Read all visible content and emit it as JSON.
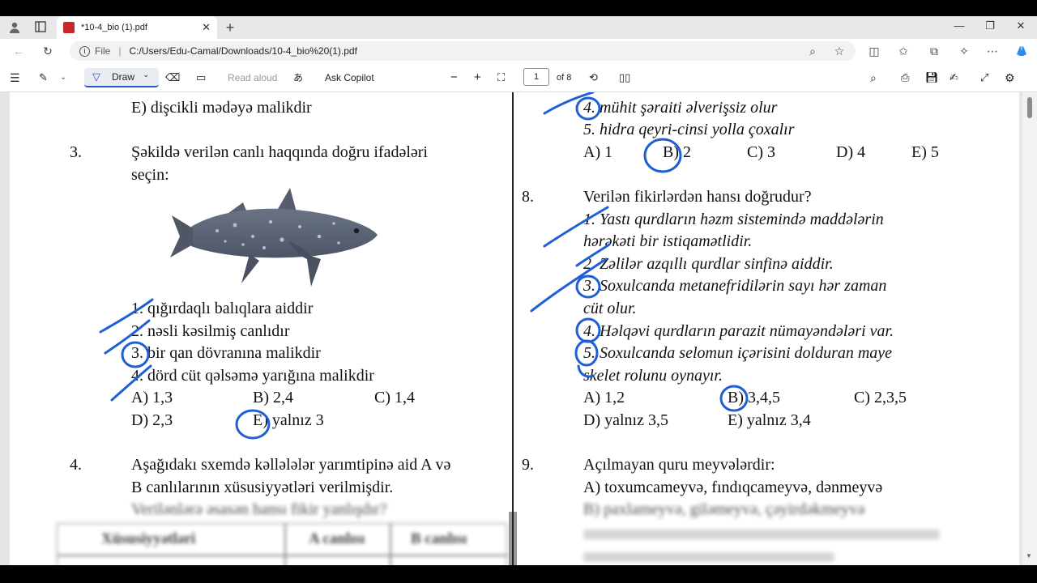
{
  "browser": {
    "tab_title": "*10-4_bio (1).pdf",
    "tab_close": "✕",
    "new_tab": "+",
    "address_prefix": "File",
    "address_url": "C:/Users/Edu-Camal/Downloads/10-4_bio%20(1).pdf"
  },
  "pdf_toolbar": {
    "draw_label": "Draw",
    "read_aloud": "Read aloud",
    "ask_copilot": "Ask Copilot",
    "page_current": "1",
    "page_total": "of 8"
  },
  "left_column": {
    "q2_option_e": "E) dişcikli mədəyə malikdir",
    "q3_number": "3.",
    "q3_text_line1": "Şəkildə verilən canlı haqqında doğru ifadələri",
    "q3_text_line2": "seçin:",
    "q3_s1": "1. qığırdaqlı balıqlara aiddir",
    "q3_s2": "2. nəsli kəsilmiş canlıdır",
    "q3_s3": "3. bir qan dövranına malikdir",
    "q3_s4": "4. dörd cüt qəlsəmə yarığına malikdir",
    "q3_a": "A) 1,3",
    "q3_b": "B) 2,4",
    "q3_c": "C) 1,4",
    "q3_d": "D) 2,3",
    "q3_e": "E) yalnız 3",
    "q4_number": "4.",
    "q4_line1": "Aşağıdakı sxemdə kəllələlər yarımtipinə aid A və",
    "q4_line2": "B canlılarının xüsusiyyətləri verilmişdir.",
    "q4_line3": "Verilənlərə əsasən hansı fikir yanlışdır?",
    "table_h1": "Xüsusiyyətləri",
    "table_h2": "A canlısı",
    "table_h3": "B canlısı"
  },
  "right_column": {
    "q7_s4": "4. mühit şəraiti əlverişsiz olur",
    "q7_s5": "5. hidra qeyri-cinsi yolla çoxalır",
    "q7_a": "A) 1",
    "q7_b": "B) 2",
    "q7_c": "C) 3",
    "q7_d": "D) 4",
    "q7_e": "E) 5",
    "q8_number": "8.",
    "q8_text": "Verilən fikirlərdən hansı doğrudur?",
    "q8_s1_l1": "1. Yastı qurdların həzm sistemində maddələrin",
    "q8_s1_l2": "hərəkəti bir istiqamətlidir.",
    "q8_s2": "2. Zəlilər azqıllı qurdlar sinfinə aiddir.",
    "q8_s3_l1": "3. Soxulcanda metanefridilərin sayı hər zaman",
    "q8_s3_l2": "cüt olur.",
    "q8_s4": "4. Həlqəvi qurdların parazit nümayəndələri var.",
    "q8_s5_l1": "5. Soxulcanda selomun içərisini dolduran maye",
    "q8_s5_l2": "skelet rolunu oynayır.",
    "q8_a": "A) 1,2",
    "q8_b": "B) 3,4,5",
    "q8_c": "C) 2,3,5",
    "q8_d": "D) yalnız 3,5",
    "q8_e": "E) yalnız 3,4",
    "q9_number": "9.",
    "q9_text": "Açılmayan quru meyvələrdir:",
    "q9_a": "A) toxumcameyvə, fındıqcameyvə, dənmeyvə",
    "q9_b": "B) paxlameyvə, giləmeyvə, çəyirdəkmeyvə"
  },
  "colors": {
    "ink": "#1f5fd6",
    "accent": "#2b57c9"
  }
}
